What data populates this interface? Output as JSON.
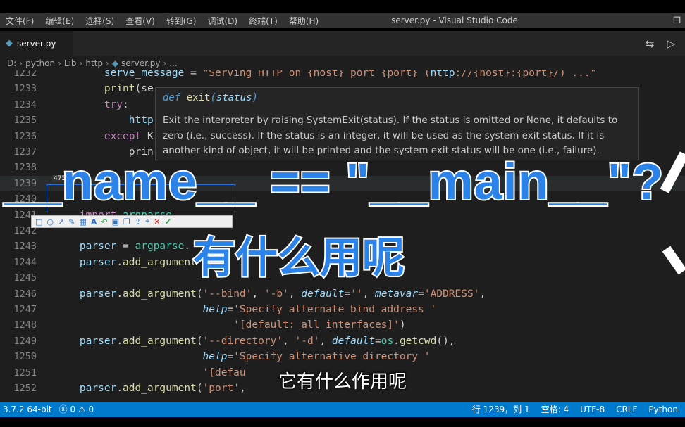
{
  "window": {
    "menu": [
      "文件(F)",
      "编辑(E)",
      "选择(S)",
      "查看(V)",
      "转到(G)",
      "调试(D)",
      "终端(T)",
      "帮助(H)"
    ],
    "title": "server.py - Visual Studio Code"
  },
  "tab": {
    "label": "server.py",
    "icon": "python-icon"
  },
  "breadcrumb": [
    "D:",
    "python",
    "Lib",
    "http",
    "server.py",
    "..."
  ],
  "editor": {
    "lines": [
      {
        "no": "1232",
        "code": "        serve_message = \"Serving HTTP on {host} port {port} (http://{host}:{port}/) ...\""
      },
      {
        "no": "1233",
        "code": "        print(se"
      },
      {
        "no": "1234",
        "code": "        try:"
      },
      {
        "no": "1235",
        "code": "            http"
      },
      {
        "no": "1236",
        "code": "        except K"
      },
      {
        "no": "1237",
        "code": "            prin"
      },
      {
        "no": "1238",
        "code": ""
      },
      {
        "no": "1239",
        "code": ""
      },
      {
        "no": "1240",
        "code": ""
      },
      {
        "no": "1241",
        "code": "    import argparse"
      },
      {
        "no": "1242",
        "code": ""
      },
      {
        "no": "1243",
        "code": "    parser = argparse."
      },
      {
        "no": "1244",
        "code": "    parser.add_argument"
      },
      {
        "no": "1245",
        "code": ""
      },
      {
        "no": "1246",
        "code": "    parser.add_argument('--bind', '-b', default='', metavar='ADDRESS',"
      },
      {
        "no": "1247",
        "code": "                        help='Specify alternate bind address '"
      },
      {
        "no": "1248",
        "code": "                             '[default: all interfaces]')"
      },
      {
        "no": "1249",
        "code": "    parser.add_argument('--directory', '-d', default=os.getcwd(),"
      },
      {
        "no": "1250",
        "code": "                        help='Specify alternative directory '"
      },
      {
        "no": "1251",
        "code": "                        '[defau"
      },
      {
        "no": "1252",
        "code": "    parser.add_argument('port',"
      }
    ]
  },
  "hover": {
    "keyword": "def",
    "name": "exit",
    "param": "status",
    "doc": "Exit the interpreter by raising SystemExit(status). If the status is omitted or None, it defaults to zero (i.e., success). If the status is an integer, it will be used as the system exit status. If it is another kind of object, it will be printed and the system exit status will be one (i.e., failure)."
  },
  "snip": {
    "size_label": "475"
  },
  "overlay": {
    "title": "__name__ == \"__main__\"?",
    "subtitle": "有什么用呢",
    "caption": "它有什么作用呢"
  },
  "statusbar": {
    "python": "3.7.2 64-bit",
    "errors": "0",
    "warnings": "0",
    "position": "行 1239，列 1",
    "spaces": "空格: 4",
    "encoding": "UTF-8",
    "eol": "CRLF",
    "language": "Python"
  },
  "colors": {
    "statusbar": "#007acc",
    "editor_bg": "#1e1e1e",
    "overlay_text": "#2b82e8"
  }
}
